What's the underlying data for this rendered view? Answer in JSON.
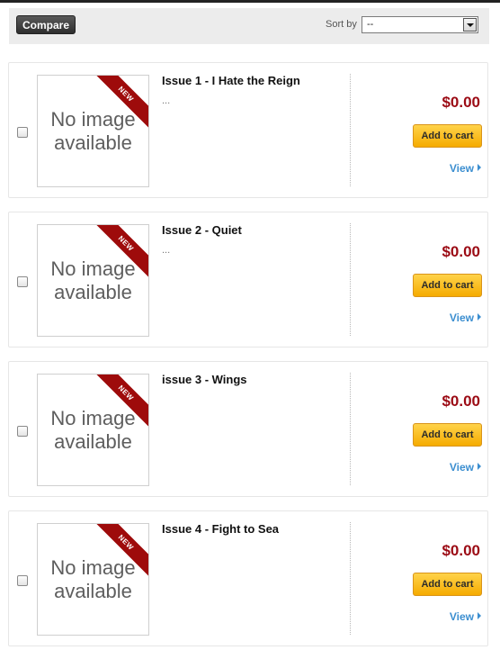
{
  "toolbar": {
    "compare_label": "Compare",
    "sort_label": "Sort by",
    "sort_value": "--"
  },
  "products": [
    {
      "title": "Issue 1 - I Hate the Reign",
      "description": "...",
      "image_text_line1": "No image",
      "image_text_line2": "available",
      "badge": "NEW",
      "price": "$0.00",
      "cart_label": "Add to cart",
      "view_label": "View"
    },
    {
      "title": "Issue 2 - Quiet",
      "description": "...",
      "image_text_line1": "No image",
      "image_text_line2": "available",
      "badge": "NEW",
      "price": "$0.00",
      "cart_label": "Add to cart",
      "view_label": "View"
    },
    {
      "title": "issue 3 - Wings",
      "description": "",
      "image_text_line1": "No image",
      "image_text_line2": "available",
      "badge": "NEW",
      "price": "$0.00",
      "cart_label": "Add to cart",
      "view_label": "View"
    },
    {
      "title": "Issue 4 - Fight to Sea",
      "description": "",
      "image_text_line1": "No image",
      "image_text_line2": "available",
      "badge": "NEW",
      "price": "$0.00",
      "cart_label": "Add to cart",
      "view_label": "View"
    }
  ],
  "colors": {
    "price": "#9b0a14",
    "badge": "#9e0b0b",
    "link": "#3b8ed0",
    "cart_button": "#f5ab00"
  },
  "icons": {
    "view": "caret-right-icon",
    "sort": "chevron-down-icon"
  }
}
